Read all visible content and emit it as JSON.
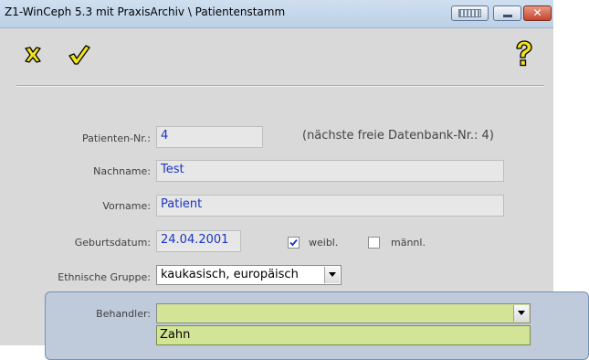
{
  "window": {
    "title": "Z1-WinCeph 5.3  mit PraxisArchiv \\ Patientenstamm",
    "buttons": {
      "keyboard_icon": "keyboard-icon",
      "minimize_icon": "minimize-icon",
      "close_label": "✕"
    }
  },
  "toolbar": {
    "cancel_icon": "cancel-x-icon",
    "ok_icon": "checkmark-icon",
    "help_icon": "question-mark-icon"
  },
  "form": {
    "patient_nr": {
      "label": "Patienten-Nr.:",
      "value": "4",
      "hint": "(nächste freie Datenbank-Nr.: 4)"
    },
    "nachname": {
      "label": "Nachname:",
      "value": "Test"
    },
    "vorname": {
      "label": "Vorname:",
      "value": "Patient"
    },
    "geburtsdatum": {
      "label": "Geburtsdatum:",
      "value": "24.04.2001"
    },
    "weibl": {
      "label": "weibl.",
      "checked": true
    },
    "maennl": {
      "label": "männl.",
      "checked": false
    },
    "ethnische_gruppe": {
      "label": "Ethnische Gruppe:",
      "selected": "kaukasisch, europäisch"
    },
    "behandler": {
      "label": "Behandler:",
      "selected": "",
      "options": [
        "Zahn"
      ]
    }
  },
  "colors": {
    "value_text": "#1a35c2",
    "window_bg": "#d9d9d9",
    "highlight_panel": "#bfcadb",
    "combo_highlight": "#d3e496"
  }
}
